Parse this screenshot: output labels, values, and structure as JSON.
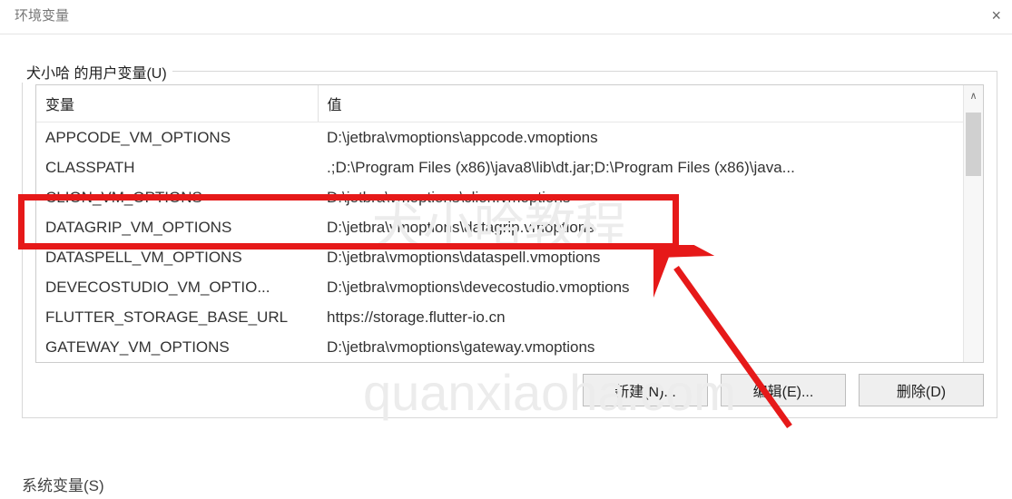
{
  "window": {
    "title": "环境变量",
    "close": "×"
  },
  "group_user": {
    "label": "犬小哈 的用户变量(U)"
  },
  "columns": {
    "variable": "变量",
    "value": "值"
  },
  "rows": [
    {
      "var": "APPCODE_VM_OPTIONS",
      "val": "D:\\jetbra\\vmoptions\\appcode.vmoptions"
    },
    {
      "var": "CLASSPATH",
      "val": ".;D:\\Program Files (x86)\\java8\\lib\\dt.jar;D:\\Program Files (x86)\\java..."
    },
    {
      "var": "CLION_VM_OPTIONS",
      "val": "D:\\jetbra\\vmoptions\\clion.vmoptions"
    },
    {
      "var": "DATAGRIP_VM_OPTIONS",
      "val": "D:\\jetbra\\vmoptions\\datagrip.vmoptions"
    },
    {
      "var": "DATASPELL_VM_OPTIONS",
      "val": "D:\\jetbra\\vmoptions\\dataspell.vmoptions"
    },
    {
      "var": "DEVECOSTUDIO_VM_OPTIO...",
      "val": "D:\\jetbra\\vmoptions\\devecostudio.vmoptions"
    },
    {
      "var": "FLUTTER_STORAGE_BASE_URL",
      "val": "https://storage.flutter-io.cn"
    },
    {
      "var": "GATEWAY_VM_OPTIONS",
      "val": "D:\\jetbra\\vmoptions\\gateway.vmoptions"
    }
  ],
  "buttons": {
    "new": "新建(N)...",
    "edit": "编辑(E)...",
    "delete": "删除(D)"
  },
  "bottom_cut": "系统变量(S)",
  "watermarks": {
    "w1": "犬小哈教程",
    "w2": "quanxiaoha.com"
  },
  "highlight_index": 3
}
